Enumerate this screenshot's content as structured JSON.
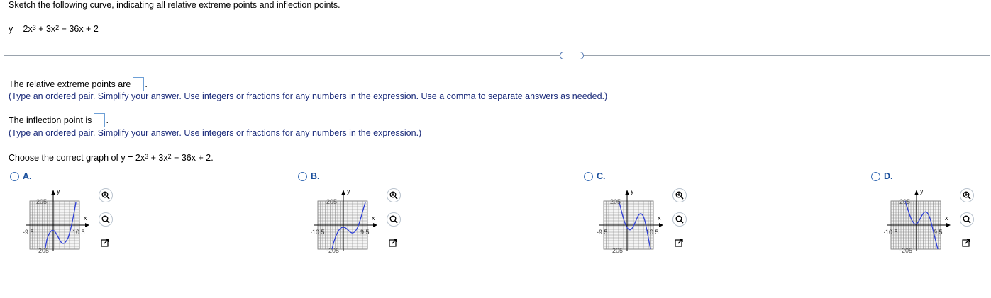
{
  "prompt": "Sketch the following curve, indicating all relative extreme points and inflection points.",
  "equation": {
    "lhs": "y = 2x",
    "exp1": "3",
    "mid": " + 3x",
    "exp2": "2",
    "rest": " − 36x + 2"
  },
  "more_button": "···",
  "extreme": {
    "text": "The relative extreme points are",
    "value": "",
    "hint": "(Type an ordered pair. Simplify your answer. Use integers or fractions for any numbers in the expression. Use a comma to separate answers as needed.)"
  },
  "inflection": {
    "text": "The inflection point is",
    "value": "",
    "hint": "(Type an ordered pair. Simplify your answer. Use integers or fractions for any numbers in the expression.)"
  },
  "choose": {
    "text": "Choose the correct graph of y = 2x",
    "exp1": "3",
    "mid": " + 3x",
    "exp2": "2",
    "rest": " − 36x + 2."
  },
  "options": [
    {
      "letter": "A.",
      "xmin_label": "-9.5",
      "xmax_label": "10.5",
      "ymax_label": "205",
      "ymin_label": "-205",
      "x_axis_label": "x",
      "y_axis_label": "y"
    },
    {
      "letter": "B.",
      "xmin_label": "-10.5",
      "xmax_label": "9.5",
      "ymax_label": "205",
      "ymin_label": "-205",
      "x_axis_label": "x",
      "y_axis_label": "y"
    },
    {
      "letter": "C.",
      "xmin_label": "-9.5",
      "xmax_label": "10.5",
      "ymax_label": "205",
      "ymin_label": "-205",
      "x_axis_label": "x",
      "y_axis_label": "y"
    },
    {
      "letter": "D.",
      "xmin_label": "-10.5",
      "xmax_label": "9.5",
      "ymax_label": "205",
      "ymin_label": "-205",
      "x_axis_label": "x",
      "y_axis_label": "y"
    }
  ],
  "colors": {
    "curve": "#2f3fd6",
    "hint": "#1a2a7a",
    "option": "#1a4f9c",
    "input_border": "#6d9fd6"
  }
}
